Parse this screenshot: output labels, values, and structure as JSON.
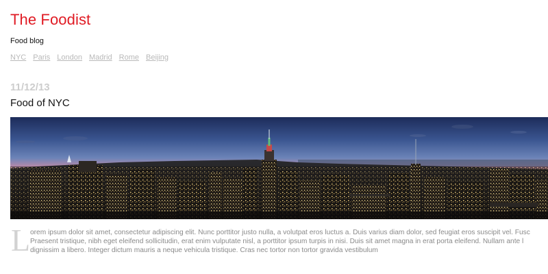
{
  "site": {
    "title": "The Foodist",
    "tagline": "Food blog"
  },
  "nav": {
    "items": [
      {
        "label": "NYC"
      },
      {
        "label": "Paris"
      },
      {
        "label": "London"
      },
      {
        "label": "Madrid"
      },
      {
        "label": "Rome"
      },
      {
        "label": "Beijing"
      }
    ]
  },
  "post": {
    "date": "11/12/13",
    "title": "Food of NYC",
    "dropcap": "L",
    "lines": [
      "orem ipsum dolor sit amet, consectetur adipiscing elit. Nunc porttitor justo nulla, a volutpat eros luctus a. Duis varius diam dolor, sed feugiat eros suscipit vel. Fusc",
      "Praesent tristique, nibh eget eleifend sollicitudin, erat enim vulputate nisl, a porttitor ipsum turpis in nisi. Duis sit amet magna in erat porta eleifend. Nullam ante l",
      "dignissim a libero. Integer dictum mauris a neque vehicula tristique. Cras nec tortor non tortor gravida vestibulum"
    ]
  },
  "colors": {
    "title": "#e01b24",
    "nav_link": "#b9b9b9",
    "date": "#cdcdcd",
    "body_text": "#8a8a8a"
  }
}
